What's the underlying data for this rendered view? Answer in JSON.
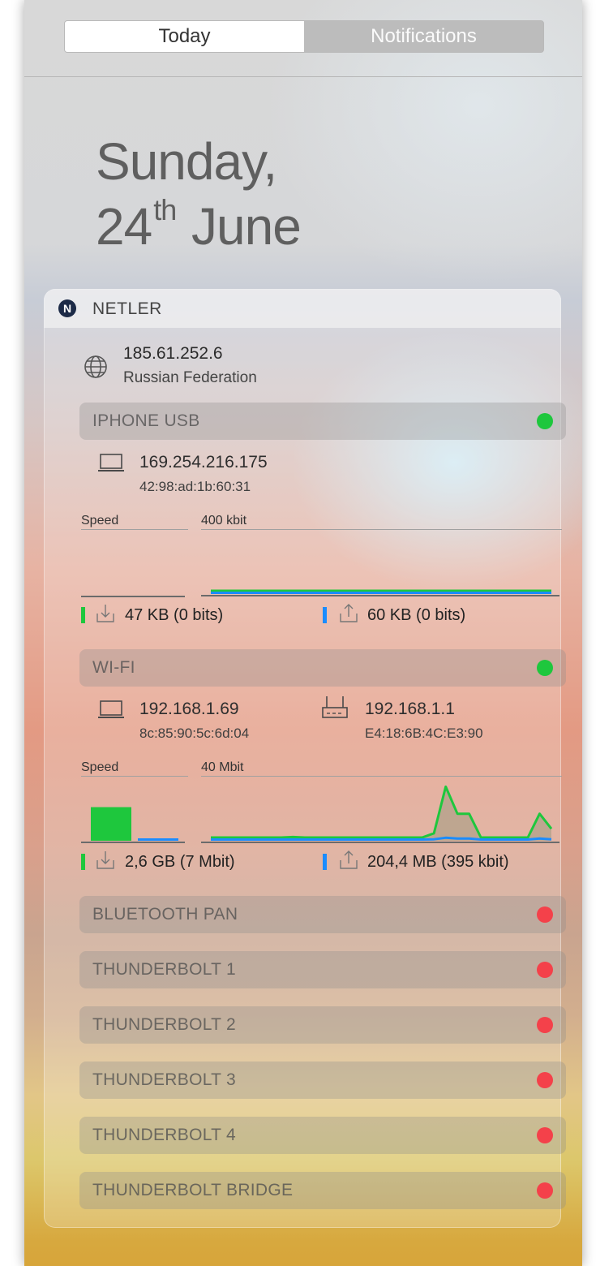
{
  "tabs": {
    "today": "Today",
    "notifications": "Notifications"
  },
  "date": {
    "weekday": "Sunday,",
    "day": "24",
    "suffix": "th",
    "month": "June"
  },
  "widget": {
    "title": "NETLER",
    "logo_letter": "N",
    "public_ip": "185.61.252.6",
    "country": "Russian Federation"
  },
  "interfaces": [
    {
      "name": "IPHONE USB",
      "status": "connected",
      "local_ip": "169.254.216.175",
      "local_mac": "42:98:ad:1b:60:31",
      "speed_label": "Speed",
      "scale": "400 kbit",
      "download": "47 KB (0 bits)",
      "upload": "60 KB (0 bits)"
    },
    {
      "name": "WI-FI",
      "status": "connected",
      "local_ip": "192.168.1.69",
      "local_mac": "8c:85:90:5c:6d:04",
      "router_ip": "192.168.1.1",
      "router_mac": "E4:18:6B:4C:E3:90",
      "speed_label": "Speed",
      "scale": "40 Mbit",
      "download": "2,6 GB (7 Mbit)",
      "upload": "204,4 MB (395 kbit)"
    },
    {
      "name": "BLUETOOTH PAN",
      "status": "disconnected"
    },
    {
      "name": "THUNDERBOLT 1",
      "status": "disconnected"
    },
    {
      "name": "THUNDERBOLT 2",
      "status": "disconnected"
    },
    {
      "name": "THUNDERBOLT 3",
      "status": "disconnected"
    },
    {
      "name": "THUNDERBOLT 4",
      "status": "disconnected"
    },
    {
      "name": "THUNDERBOLT BRIDGE",
      "status": "disconnected"
    }
  ],
  "colors": {
    "download": "#1ec73d",
    "upload": "#1a8cff",
    "status_on": "#1ec73d",
    "status_off": "#f4414a"
  },
  "icons": [
    "globe-icon",
    "laptop-icon",
    "router-icon",
    "download-icon",
    "upload-icon",
    "netler-logo"
  ],
  "chart_data": [
    {
      "type": "area",
      "title": "IPHONE USB",
      "ylabel": "400 kbit",
      "ylim": [
        0,
        400
      ],
      "series": [
        {
          "values": [
            0,
            0,
            0,
            0,
            0,
            0,
            0,
            0,
            0,
            0,
            0,
            0,
            0,
            0,
            0,
            0,
            0,
            0,
            0,
            0
          ]
        },
        {
          "values": [
            0,
            0,
            0,
            0,
            0,
            0,
            0,
            0,
            0,
            0,
            0,
            0,
            0,
            0,
            0,
            0,
            0,
            0,
            0,
            0
          ]
        }
      ]
    },
    {
      "type": "area",
      "title": "WI-FI",
      "ylabel": "40 Mbit",
      "ylim": [
        0,
        40
      ],
      "series": [
        {
          "values": [
            1.5,
            1.5,
            1.5,
            1.5,
            1.5,
            1.5,
            1.5,
            2.5,
            1.5,
            1.5,
            1.5,
            1.5,
            1.5,
            1.5,
            1.5,
            1.5,
            1.5,
            1.5,
            1.5,
            5,
            36,
            18,
            18,
            1.5,
            1.5,
            1.5,
            1.5,
            1.5,
            18,
            8
          ]
        },
        {
          "values": [
            0.4,
            0.4,
            0.4,
            0.4,
            0.4,
            0.4,
            0.4,
            0.4,
            0.4,
            0.4,
            0.4,
            0.4,
            0.4,
            0.4,
            0.4,
            0.4,
            0.4,
            0.4,
            0.4,
            1,
            2,
            1.5,
            1.5,
            0.4,
            0.4,
            0.4,
            0.4,
            0.4,
            1.5,
            1
          ]
        }
      ],
      "current": {
        "download": 7,
        "upload": 0.395
      }
    }
  ]
}
